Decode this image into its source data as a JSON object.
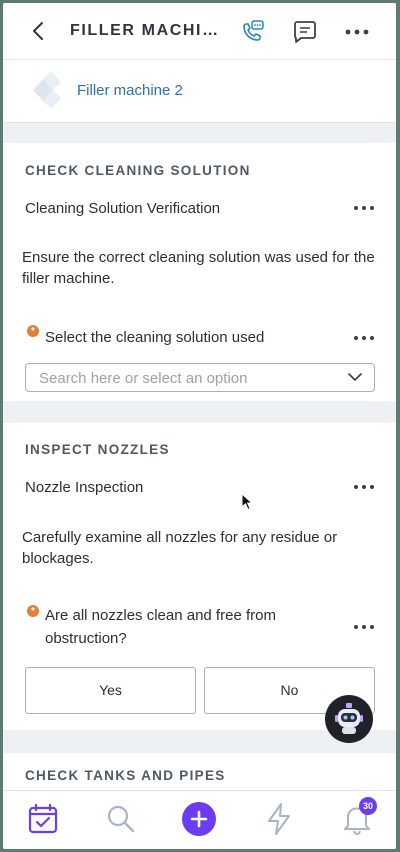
{
  "header": {
    "title": "FILLER MACHI...",
    "icons": [
      "back-icon",
      "phone-chat-icon",
      "chat-bubble-icon",
      "more-icon"
    ]
  },
  "asset": {
    "name": "Filler machine 2"
  },
  "sections": [
    {
      "title": "CHECK CLEANING SOLUTION",
      "step_title": "Cleaning Solution Verification",
      "description": "Ensure the correct cleaning solution was used for the filler machine.",
      "question": "Select the cleaning solution used",
      "select_placeholder": "Search here or select an option"
    },
    {
      "title": "INSPECT NOZZLES",
      "step_title": "Nozzle Inspection",
      "description": "Carefully examine all nozzles for any residue or blockages.",
      "question": "Are all nozzles clean and free from obstruction?",
      "yes_label": "Yes",
      "no_label": "No"
    },
    {
      "title": "CHECK TANKS AND PIPES"
    }
  ],
  "required_marker": "*",
  "bottom_nav": {
    "items": [
      "calendar-icon",
      "search-icon",
      "add-icon",
      "bolt-icon",
      "bell-icon"
    ],
    "notification_count": "30"
  },
  "colors": {
    "accent": "#6c3cf0",
    "link": "#2f6fa8",
    "required": "#e07f3c",
    "call_icon": "#2b86b8"
  }
}
